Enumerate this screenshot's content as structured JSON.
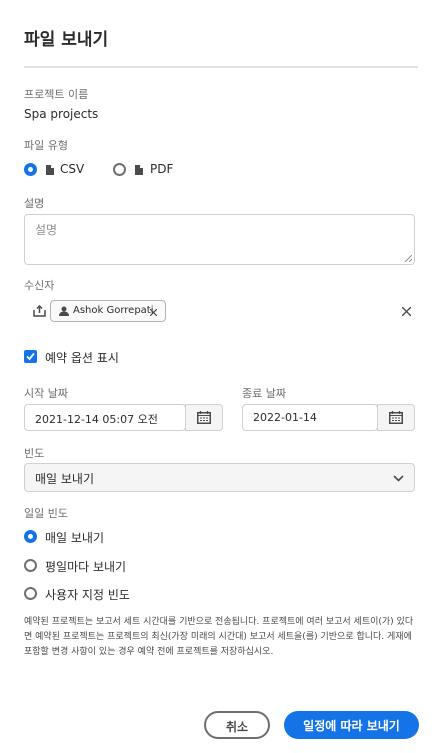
{
  "dialog": {
    "title": "파일 보내기",
    "project_name_label": "프로젝트 이름",
    "project_name_value": "Spa projects",
    "file_type_label": "파일 유형",
    "file_type_options": [
      {
        "label": "CSV",
        "selected": true
      },
      {
        "label": "PDF",
        "selected": false
      }
    ],
    "description_label": "설명",
    "description_placeholder": "설명",
    "recipient_label": "수신자",
    "recipient_tags": [
      "Ashok Gorrepati"
    ],
    "schedule_checkbox_label": "예약 옵션 표시",
    "schedule_checked": true,
    "start_date_label": "시작 날짜",
    "start_date_value": "2021-12-14 05:07 오전",
    "end_date_label": "종료 날짜",
    "end_date_value": "2022-01-14",
    "frequency_label": "빈도",
    "frequency_value": "매일 보내기",
    "daily_frequency_label": "일일 빈도",
    "daily_frequency_options": [
      {
        "label": "매일 보내기",
        "selected": true
      },
      {
        "label": "평일마다 보내기",
        "selected": false
      },
      {
        "label": "사용자 지정 빈도",
        "selected": false
      }
    ],
    "info_text": "예약된 프로젝트는 보고서 세트 시간대를 기반으로 전송됩니다. 프로젝트에 여러 보고서 세트이(가) 있다면 예약된 프로젝트는 프로젝트의 최신(가장 미래의 시간대) 보고서 세트을(를) 기반으로 합니다. 게재에 포함할 변경 사항이 있는 경우 예약 전에 프로젝트를 저장하십시오.",
    "cancel_label": "취소",
    "submit_label": "일정에 따라 보내기"
  },
  "colors": {
    "accent": "#1473e6",
    "text": "#2c2c2c",
    "label": "#6e6e6e"
  },
  "icons": [
    "csv-file-icon",
    "pdf-file-icon",
    "share-icon",
    "user-icon",
    "tag-remove-icon",
    "clear-icon",
    "checkmark-icon",
    "calendar-icon",
    "chevron-down-icon"
  ]
}
